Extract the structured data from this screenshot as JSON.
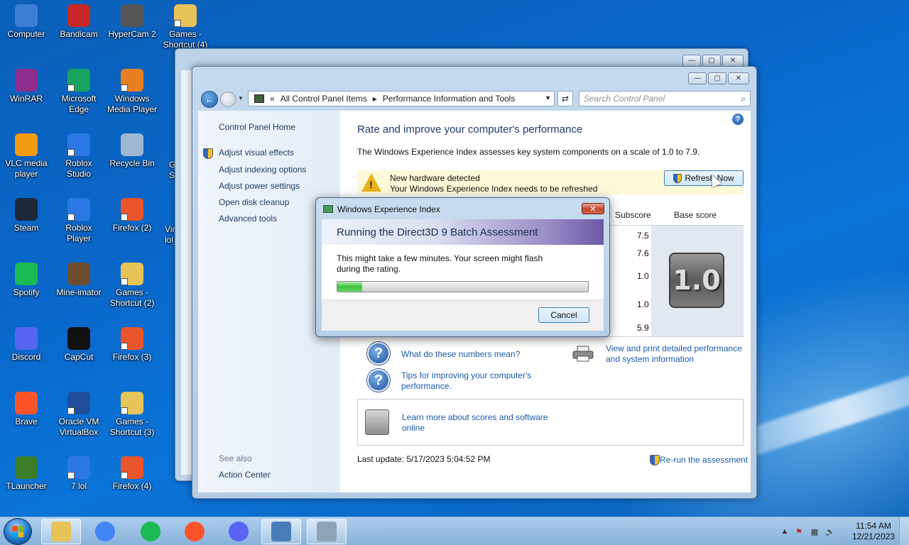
{
  "desktop": {
    "icons": [
      {
        "label": "Computer",
        "icon": "computer-icon"
      },
      {
        "label": "Bandicam",
        "icon": "bandicam-icon"
      },
      {
        "label": "HyperCam 2",
        "icon": "hypercam-icon"
      },
      {
        "label": "Games - Shortcut (4)",
        "icon": "folder-icon"
      },
      {
        "label": "WinRAR",
        "icon": "winrar-icon"
      },
      {
        "label": "Microsoft Edge",
        "icon": "edge-icon"
      },
      {
        "label": "Windows Media Player",
        "icon": "media-player-icon"
      },
      {
        "label": "VLC media player",
        "icon": "vlc-icon"
      },
      {
        "label": "Roblox Studio",
        "icon": "roblox-studio-icon"
      },
      {
        "label": "Recycle Bin",
        "icon": "recycle-bin-icon"
      },
      {
        "label": "Steam",
        "icon": "steam-icon"
      },
      {
        "label": "Roblox Player",
        "icon": "roblox-icon"
      },
      {
        "label": "Firefox (2)",
        "icon": "firefox-icon"
      },
      {
        "label": "Spotify",
        "icon": "spotify-icon"
      },
      {
        "label": "Mine-imator",
        "icon": "mine-imator-icon"
      },
      {
        "label": "Games - Shortcut (2)",
        "icon": "folder-icon"
      },
      {
        "label": "Discord",
        "icon": "discord-icon"
      },
      {
        "label": "CapCut",
        "icon": "capcut-icon"
      },
      {
        "label": "Firefox (3)",
        "icon": "firefox-icon"
      },
      {
        "label": "Brave",
        "icon": "brave-icon"
      },
      {
        "label": "Oracle VM VirtualBox",
        "icon": "virtualbox-icon"
      },
      {
        "label": "Games - Shortcut (3)",
        "icon": "folder-icon"
      },
      {
        "label": "TLauncher",
        "icon": "tlauncher-icon"
      },
      {
        "label": "7 lol",
        "icon": "roblox-icon"
      },
      {
        "label": "Firefox (4)",
        "icon": "firefox-icon"
      }
    ],
    "partial_labels": [
      "Vir",
      "lol_",
      "G",
      "S"
    ]
  },
  "window": {
    "breadcrumb": [
      "All Control Panel Items",
      "Performance Information and Tools"
    ],
    "breadcrumb_sep": "«",
    "breadcrumb_arrow": "▸",
    "search_placeholder": "Search Control Panel",
    "help": "?",
    "left_pane": {
      "home": "Control Panel Home",
      "links": [
        "Adjust visual effects",
        "Adjust indexing options",
        "Adjust power settings",
        "Open disk cleanup",
        "Advanced tools"
      ],
      "see_also": "See also",
      "action_center": "Action Center"
    },
    "main": {
      "title": "Rate and improve your computer's performance",
      "description": "The Windows Experience Index assesses key system components on a scale of 1.0 to 7.9.",
      "warning_title": "New hardware detected",
      "warning_text": "Your Windows Experience Index needs to be refreshed",
      "refresh_button": "Refresh Now",
      "col_subscore": "Subscore",
      "col_base": "Base score",
      "subscores": [
        "7.5",
        "7.6",
        "1.0",
        "1.0",
        "5.9"
      ],
      "base_score": "1.0",
      "link_numbers": "What do these numbers mean?",
      "link_tips": "Tips for improving your computer's performance.",
      "link_print": "View and print detailed performance and system information",
      "link_learn": "Learn more about scores and software online",
      "last_update": "Last update: 5/17/2023 5:04:52 PM",
      "rerun": "Re-run the assessment"
    }
  },
  "dialog": {
    "title": "Windows Experience Index",
    "heading": "Running the Direct3D 9 Batch Assessment",
    "message": "This might take a few minutes. Your screen might flash during the rating.",
    "progress": 0.1,
    "cancel": "Cancel",
    "close": "✕"
  },
  "taskbar": {
    "apps": [
      "file-explorer-icon",
      "chrome-icon",
      "spotify-icon",
      "brave-icon",
      "discord-icon",
      "control-panel-icon",
      "calculator-icon"
    ],
    "time": "11:54 AM",
    "date": "12/21/2023",
    "tray_arrow": "▲"
  },
  "colors": {
    "accent": "#1e3a6e",
    "link": "#1c5aa8",
    "progress": "#3cc23c"
  }
}
